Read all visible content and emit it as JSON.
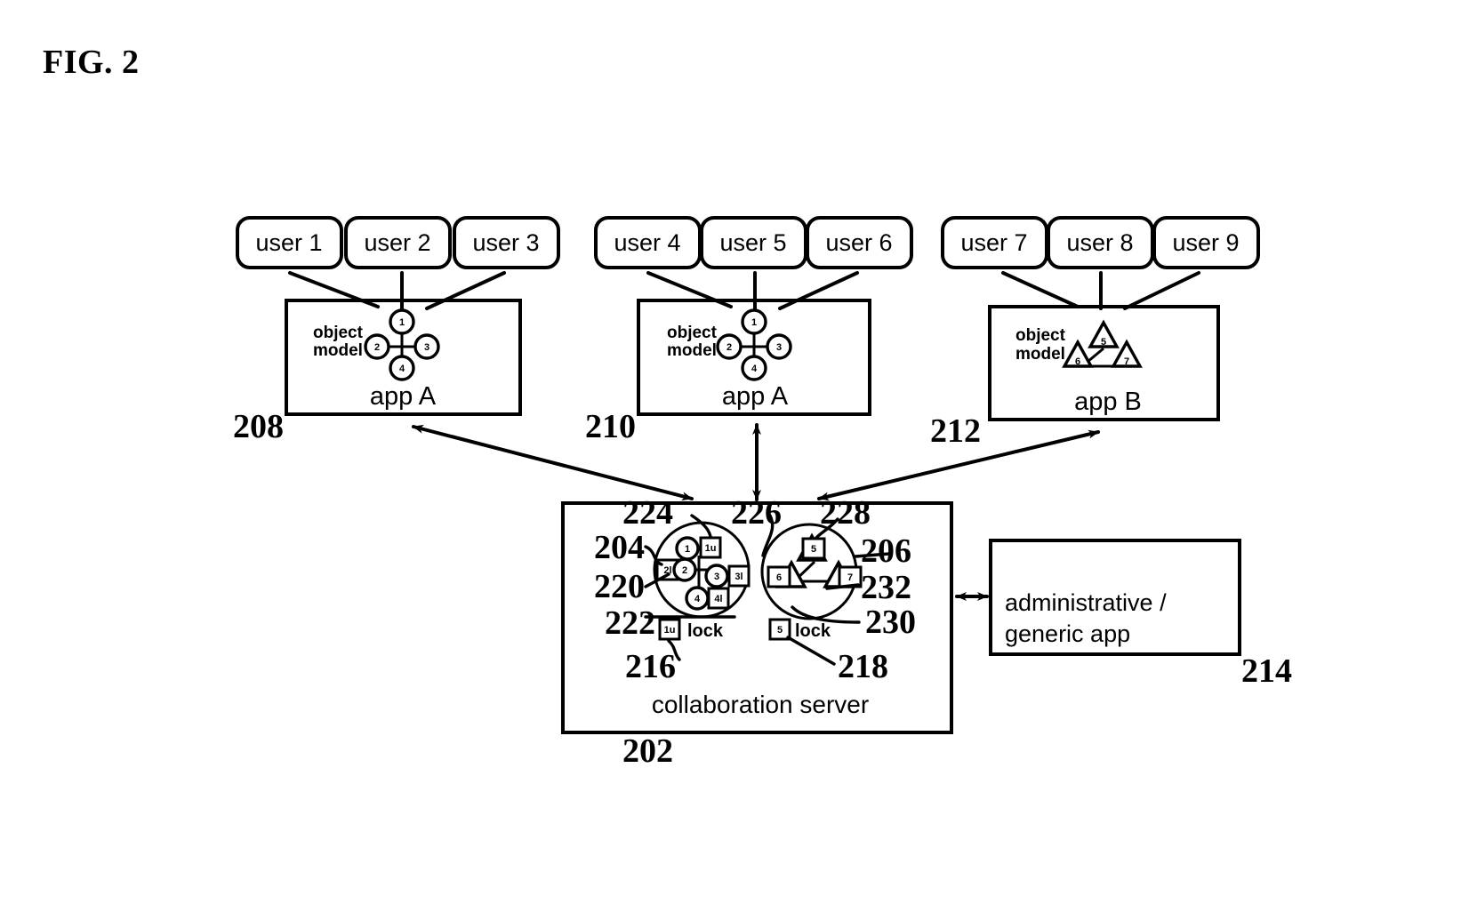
{
  "figure": {
    "label": "FIG. 2"
  },
  "users": {
    "group_a": [
      {
        "id": "user-1",
        "label": "user 1"
      },
      {
        "id": "user-2",
        "label": "user 2"
      },
      {
        "id": "user-3",
        "label": "user 3"
      }
    ],
    "group_b": [
      {
        "id": "user-4",
        "label": "user 4"
      },
      {
        "id": "user-5",
        "label": "user 5"
      },
      {
        "id": "user-6",
        "label": "user 6"
      }
    ],
    "group_c": [
      {
        "id": "user-7",
        "label": "user 7"
      },
      {
        "id": "user-8",
        "label": "user 8"
      },
      {
        "id": "user-9",
        "label": "user 9"
      }
    ]
  },
  "apps": {
    "app_left": {
      "name": "app A",
      "object_model_line1": "object",
      "object_model_line2": "model",
      "ref": "208",
      "model_type": "circle-cross",
      "node_labels": [
        "1",
        "2",
        "3",
        "4"
      ]
    },
    "app_middle": {
      "name": "app A",
      "object_model_line1": "object",
      "object_model_line2": "model",
      "ref": "210",
      "model_type": "circle-cross",
      "node_labels": [
        "1",
        "2",
        "3",
        "4"
      ]
    },
    "app_right": {
      "name": "app B",
      "object_model_line1": "object",
      "object_model_line2": "model",
      "ref": "212",
      "model_type": "triangle-triad",
      "node_labels": [
        "5",
        "6",
        "7"
      ]
    }
  },
  "server": {
    "title": "collaboration server",
    "ref": "202",
    "object_group_left": {
      "ref": "204",
      "node_ref": "220",
      "lock_ref": "222",
      "node_labels": [
        "1",
        "2",
        "3",
        "4"
      ],
      "lock_labels": [
        "1u",
        "2l",
        "3l",
        "4l"
      ]
    },
    "object_group_right": {
      "ref": "206",
      "node_ref": "232",
      "lock_ref": "230",
      "node_labels": [
        "5",
        "6",
        "7"
      ],
      "lock_labels": [
        "5",
        "6",
        "7"
      ]
    },
    "legend": [
      {
        "ref": "216",
        "pointer_ref": "222",
        "icon": "lock-square-icon",
        "label": "lock"
      },
      {
        "ref": "218",
        "pointer_ref": "230",
        "icon": "lock-square-icon",
        "label": "lock"
      }
    ],
    "link_refs": [
      {
        "ref": "224"
      },
      {
        "ref": "226"
      },
      {
        "ref": "228"
      }
    ]
  },
  "admin_app": {
    "line1": "administrative /",
    "line2": "generic app",
    "ref": "214"
  },
  "colors": {
    "stroke": "#000000",
    "background": "#ffffff"
  }
}
